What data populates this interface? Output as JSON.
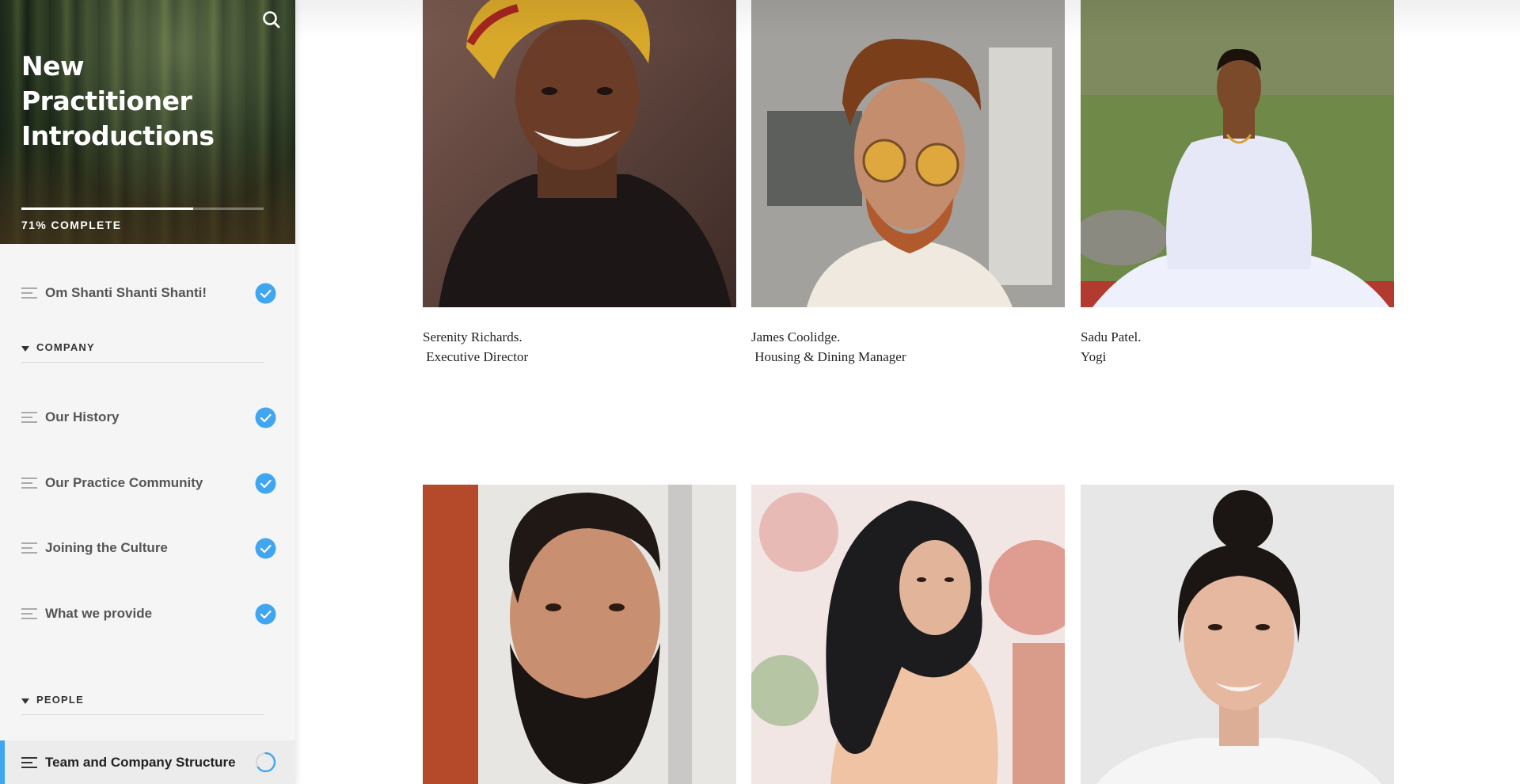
{
  "course": {
    "title": "New Practitioner Introductions",
    "progress_percent": 71,
    "progress_label": "71% COMPLETE"
  },
  "sidebar": {
    "items": [
      {
        "label": "Om Shanti Shanti Shanti!",
        "status": "complete"
      }
    ],
    "sections": [
      {
        "title": "COMPANY",
        "items": [
          {
            "label": "Our History",
            "status": "complete"
          },
          {
            "label": "Our Practice Community",
            "status": "complete"
          },
          {
            "label": "Joining the Culture",
            "status": "complete"
          },
          {
            "label": "What we provide",
            "status": "complete"
          }
        ]
      },
      {
        "title": "PEOPLE",
        "items": [
          {
            "label": "Team and Company Structure",
            "status": "in-progress",
            "active": true
          }
        ]
      }
    ]
  },
  "people": [
    {
      "name": "Serenity Richards.",
      "role": " Executive Director"
    },
    {
      "name": "James Coolidge.",
      "role": " Housing & Dining Manager"
    },
    {
      "name": "Sadu Patel.",
      "role": "Yogi"
    },
    {
      "name": "",
      "role": ""
    },
    {
      "name": "",
      "role": ""
    },
    {
      "name": "",
      "role": ""
    }
  ],
  "colors": {
    "accent": "#41a6f2",
    "check": "#41a6f2"
  }
}
